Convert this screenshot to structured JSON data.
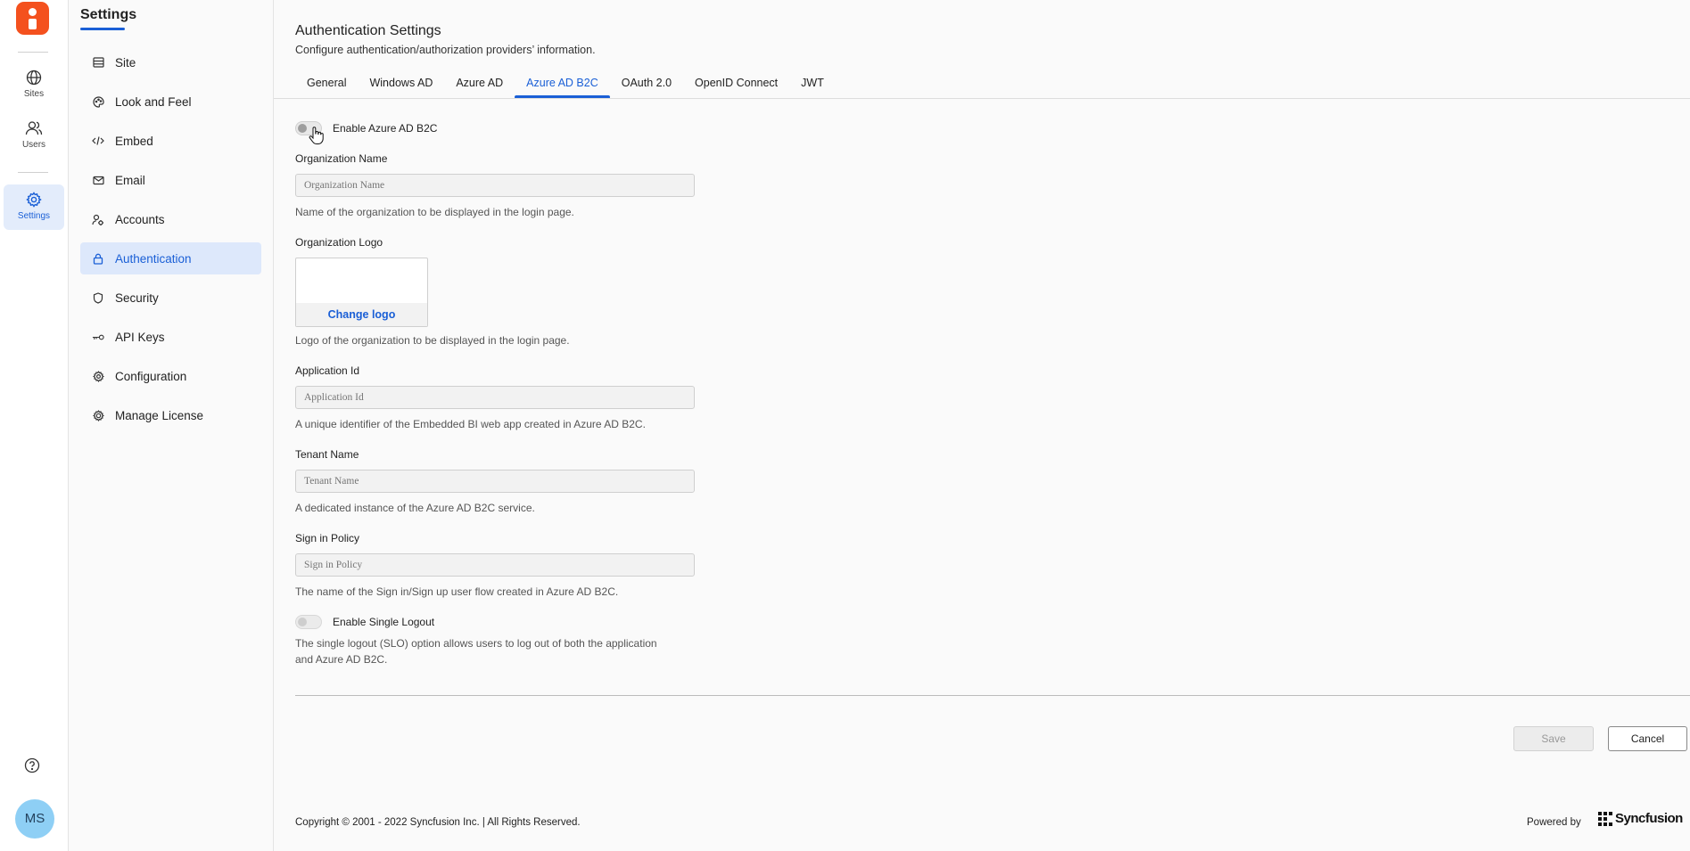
{
  "rail": {
    "items": [
      {
        "label": "Sites",
        "icon": "globe-icon"
      },
      {
        "label": "Users",
        "icon": "users-icon"
      },
      {
        "label": "Settings",
        "icon": "gear-icon"
      }
    ],
    "avatar_initials": "MS",
    "accent": "#1a5fd6",
    "brand_color": "#f4511e"
  },
  "sidebar": {
    "title": "Settings",
    "items": [
      {
        "label": "Site",
        "icon": "site-icon"
      },
      {
        "label": "Look and Feel",
        "icon": "palette-icon"
      },
      {
        "label": "Embed",
        "icon": "code-icon"
      },
      {
        "label": "Email",
        "icon": "mail-icon"
      },
      {
        "label": "Accounts",
        "icon": "accounts-icon"
      },
      {
        "label": "Authentication",
        "icon": "lock-icon",
        "active": true
      },
      {
        "label": "Security",
        "icon": "shield-icon"
      },
      {
        "label": "API Keys",
        "icon": "key-icon"
      },
      {
        "label": "Configuration",
        "icon": "config-gear-icon"
      },
      {
        "label": "Manage License",
        "icon": "license-icon"
      }
    ]
  },
  "main": {
    "title": "Authentication Settings",
    "subtitle": "Configure authentication/authorization providers’ information.",
    "tabs": [
      {
        "label": "General"
      },
      {
        "label": "Windows AD"
      },
      {
        "label": "Azure AD"
      },
      {
        "label": "Azure AD B2C",
        "active": true
      },
      {
        "label": "OAuth 2.0"
      },
      {
        "label": "OpenID Connect"
      },
      {
        "label": "JWT"
      }
    ],
    "enable_toggle_label": "Enable Azure AD B2C",
    "enable_toggle_on": false,
    "org_name": {
      "label": "Organization Name",
      "placeholder": "Organization Name",
      "value": "",
      "help": "Name of the organization to be displayed in the login page."
    },
    "org_logo": {
      "label": "Organization Logo",
      "change_label": "Change logo",
      "help": "Logo of the organization to be displayed in the login page."
    },
    "app_id": {
      "label": "Application Id",
      "placeholder": "Application Id",
      "value": "",
      "help": "A unique identifier of the Embedded BI web app created in Azure AD B2C."
    },
    "tenant": {
      "label": "Tenant Name",
      "placeholder": "Tenant Name",
      "value": "",
      "help": "A dedicated instance of the Azure AD B2C service."
    },
    "policy": {
      "label": "Sign in Policy",
      "placeholder": "Sign in Policy",
      "value": "",
      "help": "The name of the Sign in/Sign up user flow created in Azure AD B2C."
    },
    "slo": {
      "label": "Enable Single Logout",
      "on": false,
      "help_line1": "The single logout (SLO) option allows users to log out of both the application",
      "help_line2": "and Azure AD B2C."
    },
    "buttons": {
      "save": "Save",
      "cancel": "Cancel"
    }
  },
  "footer": {
    "copyright": "Copyright © 2001 - 2022 Syncfusion Inc. | All Rights Reserved.",
    "powered_by": "Powered by",
    "brand": "Syncfusion"
  }
}
